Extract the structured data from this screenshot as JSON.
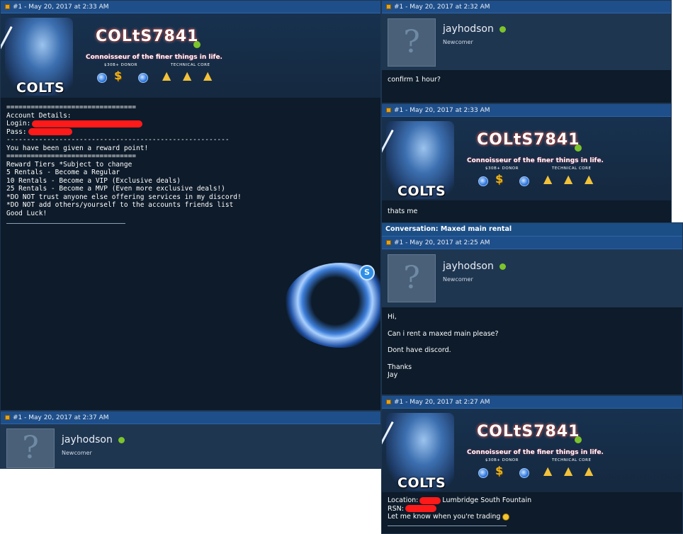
{
  "colors": {
    "postbar": "#1f4f8a",
    "panel": "#0d1b2a",
    "userbar": "#1f3651",
    "online": "#7cc42b",
    "redaction": "#ff1a1a"
  },
  "posts": {
    "p1_date": "#1 - May 20, 2017 at 2:33 AM",
    "p2_date": "#1 - May 20, 2017 at 2:32 AM",
    "p3_date": "#1 - May 20, 2017 at 2:33 AM",
    "p4_date": "#1 - May 20, 2017 at 2:37 AM",
    "p5_date": "#1 - May 20, 2017 at 2:25 AM",
    "p6_date": "#1 - May 20, 2017 at 2:27 AM"
  },
  "banner": {
    "name": "COLtS7841",
    "tagline": "Connoisseur of the finer things in life.",
    "donor": "$30B+ DONOR",
    "tech": "TECHNICAL CORE",
    "colts": "COLTS"
  },
  "user": {
    "name": "jayhodson",
    "title": "Newcomer"
  },
  "post1": {
    "lines": [
      "================================",
      "Account Details:",
      "Login:",
      "Pass:",
      "-------------------------------------------------------",
      "You have been given a reward point!",
      "================================",
      "Reward Tiers *Subject to change",
      "5 Rentals - Become a Regular",
      "10 Rentals - Become a VIP (Exclusive deals)",
      "25 Rentals - Become a MVP (Even more exclusive deals!)",
      "*DO NOT trust anyone else offering services in my discord!",
      "*DO NOT add others/yourself to the accounts friends list",
      "Good Luck!"
    ]
  },
  "post2": {
    "text": "confirm 1 hour?"
  },
  "post3": {
    "text": "thats me"
  },
  "conversation": {
    "title": "Conversation: Maxed main rental"
  },
  "post5": {
    "lines": [
      "Hi,",
      "Can i rent a maxed main please?",
      "Dont have discord.",
      "Thanks",
      "Jay"
    ]
  },
  "post6": {
    "location_label": "Location:",
    "location_value": "Lumbridge South Fountain",
    "rsn_label": "RSN:",
    "closing": "Let me know when you're trading"
  },
  "icons": {
    "post": "post-icon",
    "online": "online-dot",
    "avatar": "question-mark-avatar",
    "smile": "smiley-icon",
    "skype": "skype-icon"
  }
}
